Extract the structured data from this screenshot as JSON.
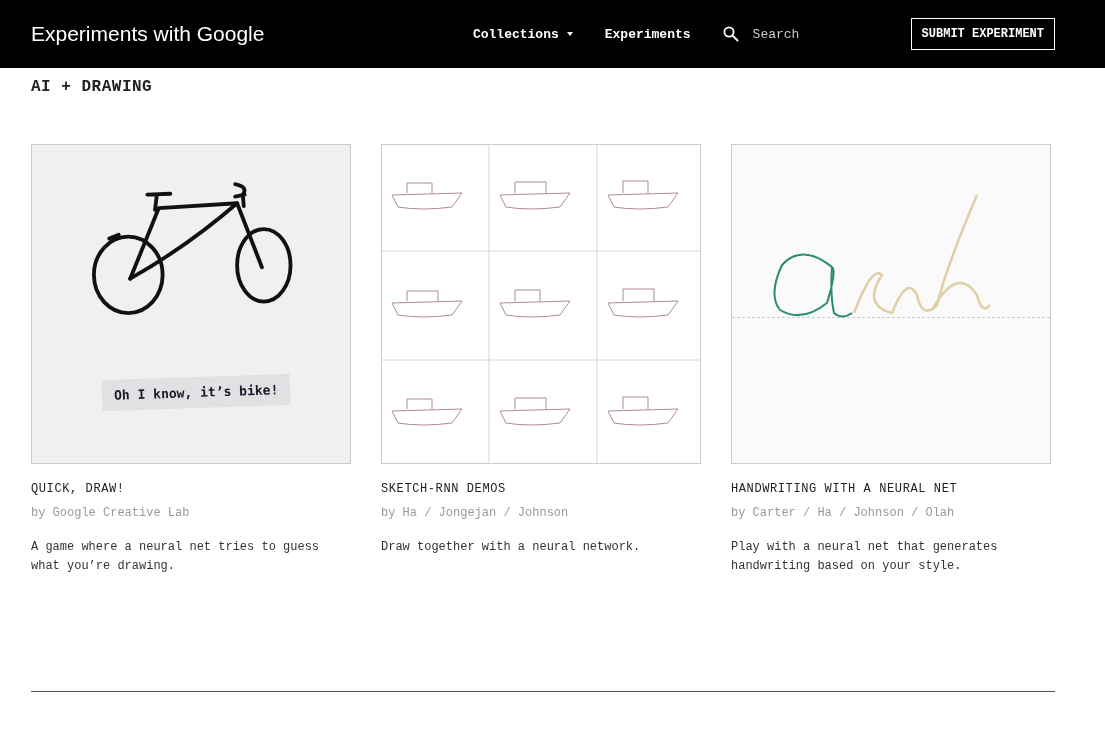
{
  "header": {
    "logo": "Experiments with Google",
    "nav": [
      {
        "label": "Collections",
        "kind": "dropdown"
      },
      {
        "label": "Experiments",
        "kind": "link"
      }
    ],
    "search": {
      "placeholder": "Search"
    },
    "submit_button": "SUBMIT EXPERIMENT"
  },
  "section_title": "AI + DRAWING",
  "cards": [
    {
      "kind": "bike",
      "thumbnail_caption": "Oh I know, it’s bike!",
      "title": "QUICK, DRAW!",
      "authors": "by Google Creative Lab",
      "description": "A game where a neural net tries to guess what you’re drawing."
    },
    {
      "kind": "boats",
      "title": "SKETCH-RNN DEMOS",
      "authors": "by Ha / Jongejan / Johnson",
      "description": "Draw together with a neural network."
    },
    {
      "kind": "handwriting",
      "title": "HANDWRITING WITH A NEURAL NET",
      "authors": "by Carter / Ha / Johnson / Olah",
      "description": "Play with a neural net that generates handwriting based on your style."
    }
  ]
}
